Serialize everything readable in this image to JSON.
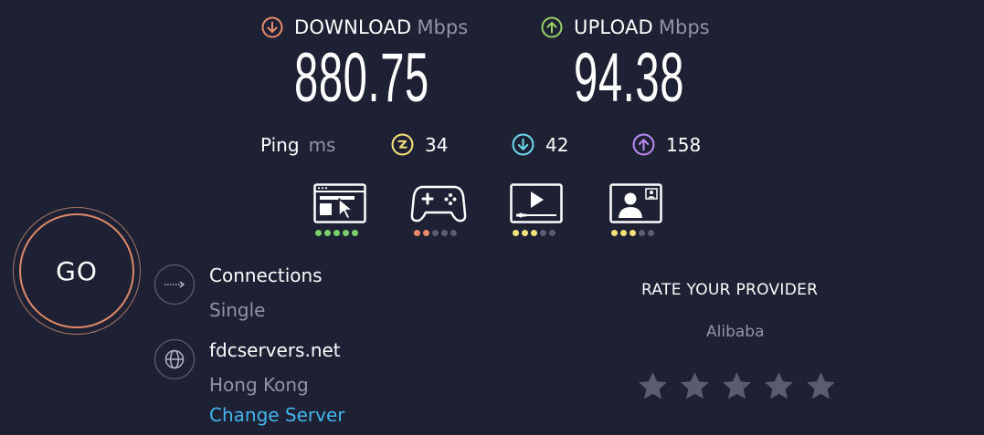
{
  "download": {
    "label": "DOWNLOAD",
    "unit": "Mbps",
    "value": "880.75",
    "color": "#e98a6a"
  },
  "upload": {
    "label": "UPLOAD",
    "unit": "Mbps",
    "value": "94.38",
    "color": "#9ad06a"
  },
  "ping": {
    "label": "Ping",
    "unit": "ms",
    "idle": {
      "value": "34",
      "color": "#f2e07a"
    },
    "download": {
      "value": "42",
      "color": "#6ad6e8"
    },
    "upload": {
      "value": "158",
      "color": "#b889f0"
    }
  },
  "quality": [
    {
      "icon": "web-browsing-icon",
      "rating": 5,
      "color": "#7ad06a"
    },
    {
      "icon": "gaming-controller-icon",
      "rating": 2,
      "color": "#e98a6a"
    },
    {
      "icon": "video-streaming-icon",
      "rating": 3,
      "color": "#f2e07a"
    },
    {
      "icon": "video-call-icon",
      "rating": 3,
      "color": "#f2e07a"
    }
  ],
  "go_label": "GO",
  "connections": {
    "title": "Connections",
    "value": "Single"
  },
  "server": {
    "host": "fdcservers.net",
    "location": "Hong Kong",
    "change_label": "Change Server"
  },
  "rate": {
    "title": "RATE YOUR PROVIDER",
    "provider": "Alibaba",
    "stars": 0
  }
}
